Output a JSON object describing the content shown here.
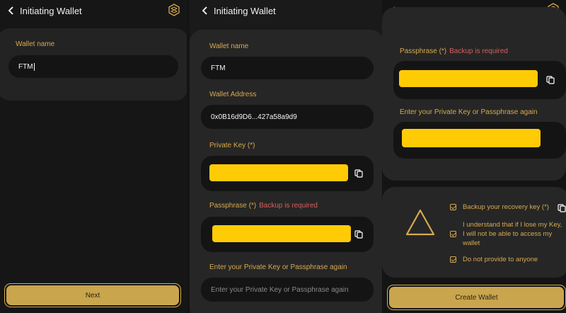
{
  "header": {
    "title": "Initiating Wallet"
  },
  "screen1": {
    "wallet_name_label": "Wallet name",
    "wallet_name_value": "FTM",
    "next_button": "Next"
  },
  "screen2": {
    "wallet_name_label": "Wallet name",
    "wallet_name_value": "FTM",
    "wallet_address_label": "Wallet Address",
    "wallet_address_value": "0x0B16d9D6...427a58a9d9",
    "private_key_label": "Private Key (*)",
    "passphrase_label": "Passphrase (*)",
    "backup_required": "Backup is required",
    "reenter_label": "Enter your Private Key or Passphrase again",
    "reenter_placeholder": "Enter your Private Key or Passphrase again"
  },
  "screen3": {
    "passphrase_label": "Passphrase (*)",
    "backup_required": "Backup is required",
    "reenter_label": "Enter your Private Key or Passphrase again",
    "checks": [
      "Backup your recovery key (*)",
      "I understand that if I lose my Key, I will not be able to access my wallet",
      "Do not provide to anyone"
    ],
    "create_button": "Create Wallet"
  },
  "colors": {
    "accent": "#d6aa4f",
    "warning": "#d85d5d",
    "redaction": "#ffcb05",
    "button": "#c9a54e"
  }
}
